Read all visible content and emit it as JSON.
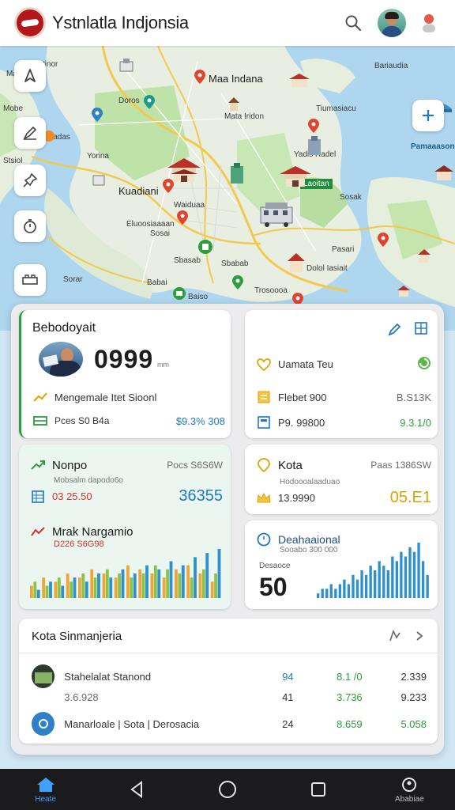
{
  "header": {
    "title": "Ystnlatla Indjonsia"
  },
  "map": {
    "labels": [
      "Ibatinor",
      "Mao",
      "Mobe",
      "Doros",
      "Yorina",
      "Stsiol",
      "Kuadiani",
      "Waiduaa",
      "Eluoosiaaaan",
      "Sosai",
      "Sorar",
      "Sbasab",
      "Sbabab",
      "Baiso",
      "Mata Iridon",
      "Maa Indana",
      "Tiumasiacu",
      "Yadis Radel",
      "Pamaaasonas",
      "Bariaudia",
      "Babai",
      "Laoitan",
      "Pasari",
      "Sosak",
      "Dolol Iasiait",
      "Trosoooa",
      "Dadas"
    ]
  },
  "cards": {
    "summary": {
      "title": "Bebodoyait",
      "big_number": "0999",
      "big_unit": "mm",
      "row1_label": "Mengemale Itet Sioonl",
      "row2_label": "Pces S0 B4a",
      "row2_value": "$9.3% 308"
    },
    "status": {
      "row1_label": "Uamata Teu",
      "row2_label": "Flebet 900",
      "row2_value": "B.S13K",
      "row3_label": "P9. 99800",
      "row3_value": "9.3.1/0"
    },
    "nonpo": {
      "title": "Nonpo",
      "title_value": "Pocs S6S6W",
      "sub_label": "Mobsalm dapodo6o",
      "sub_value": "03 25.50",
      "value": "36355",
      "section2_title": "Mrak Nargamio",
      "section2_sub": "D226 S6G98"
    },
    "kota": {
      "title": "Kota",
      "title_value": "Paas 1386SW",
      "sub_label": "Hodoooalaaduao",
      "sub_value": "13.9990",
      "value": "05.E1"
    },
    "deah": {
      "title": "Deahaaional",
      "sub": "Sooabo 300 000",
      "small": "Desaoce",
      "value": "50"
    },
    "list": {
      "title": "Kota Sinmanjeria",
      "rows": [
        {
          "name": "Stahelalat Stanond",
          "c1": "94",
          "c2": "8.1 /0",
          "c3": "2.339"
        },
        {
          "name": "3.6.928",
          "c1": "41",
          "c2": "3.736",
          "c3": "9.233"
        },
        {
          "name": "Manarloale | Sota | Derosacia",
          "c1": "24",
          "c2": "8.659",
          "c3": "5.058"
        }
      ]
    }
  },
  "chart_data": [
    {
      "type": "bar",
      "series": [
        {
          "name": "",
          "color": "#f0a53a",
          "values": [
            3,
            5,
            4,
            6,
            5,
            7,
            6,
            5,
            8,
            7,
            6,
            5,
            7,
            8,
            6,
            4
          ]
        },
        {
          "name": "",
          "color": "#8bc34a",
          "values": [
            4,
            3,
            5,
            4,
            6,
            5,
            7,
            6,
            5,
            6,
            8,
            7,
            6,
            5,
            7,
            6
          ]
        },
        {
          "name": "",
          "color": "#2f8fcf",
          "values": [
            2,
            4,
            3,
            5,
            4,
            6,
            5,
            7,
            6,
            8,
            7,
            9,
            8,
            10,
            11,
            12
          ]
        }
      ]
    },
    {
      "type": "bar",
      "values": [
        1,
        2,
        2,
        3,
        2,
        3,
        4,
        3,
        5,
        4,
        6,
        5,
        7,
        6,
        8,
        7,
        6,
        9,
        8,
        10,
        9,
        11,
        10,
        12,
        8,
        5
      ]
    }
  ],
  "nav": {
    "items": [
      "Heate",
      "",
      "",
      "",
      "Ababiae"
    ]
  }
}
